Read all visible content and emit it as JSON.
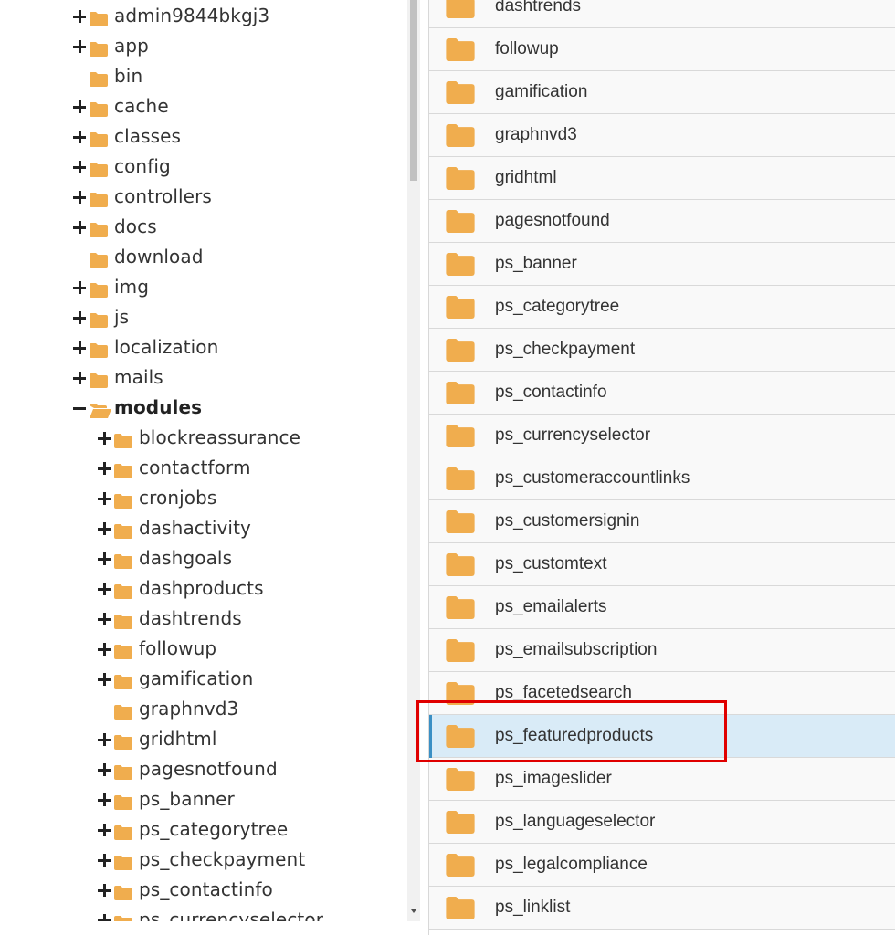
{
  "colors": {
    "folder": "#f0ad4e",
    "selected_row": "#d9ebf7",
    "highlight": "#e00000"
  },
  "tree": {
    "items": [
      {
        "label": "admin9844bkgj3",
        "toggle": "plus",
        "level": 0
      },
      {
        "label": "app",
        "toggle": "plus",
        "level": 0
      },
      {
        "label": "bin",
        "toggle": "none",
        "level": 0
      },
      {
        "label": "cache",
        "toggle": "plus",
        "level": 0
      },
      {
        "label": "classes",
        "toggle": "plus",
        "level": 0
      },
      {
        "label": "config",
        "toggle": "plus",
        "level": 0
      },
      {
        "label": "controllers",
        "toggle": "plus",
        "level": 0
      },
      {
        "label": "docs",
        "toggle": "plus",
        "level": 0
      },
      {
        "label": "download",
        "toggle": "none",
        "level": 0
      },
      {
        "label": "img",
        "toggle": "plus",
        "level": 0
      },
      {
        "label": "js",
        "toggle": "plus",
        "level": 0
      },
      {
        "label": "localization",
        "toggle": "plus",
        "level": 0
      },
      {
        "label": "mails",
        "toggle": "plus",
        "level": 0
      },
      {
        "label": "modules",
        "toggle": "minus",
        "level": 0,
        "open": true,
        "bold": true
      },
      {
        "label": "blockreassurance",
        "toggle": "plus",
        "level": 1
      },
      {
        "label": "contactform",
        "toggle": "plus",
        "level": 1
      },
      {
        "label": "cronjobs",
        "toggle": "plus",
        "level": 1
      },
      {
        "label": "dashactivity",
        "toggle": "plus",
        "level": 1
      },
      {
        "label": "dashgoals",
        "toggle": "plus",
        "level": 1
      },
      {
        "label": "dashproducts",
        "toggle": "plus",
        "level": 1
      },
      {
        "label": "dashtrends",
        "toggle": "plus",
        "level": 1
      },
      {
        "label": "followup",
        "toggle": "plus",
        "level": 1
      },
      {
        "label": "gamification",
        "toggle": "plus",
        "level": 1
      },
      {
        "label": "graphnvd3",
        "toggle": "none",
        "level": 1
      },
      {
        "label": "gridhtml",
        "toggle": "plus",
        "level": 1
      },
      {
        "label": "pagesnotfound",
        "toggle": "plus",
        "level": 1
      },
      {
        "label": "ps_banner",
        "toggle": "plus",
        "level": 1
      },
      {
        "label": "ps_categorytree",
        "toggle": "plus",
        "level": 1
      },
      {
        "label": "ps_checkpayment",
        "toggle": "plus",
        "level": 1
      },
      {
        "label": "ps_contactinfo",
        "toggle": "plus",
        "level": 1
      },
      {
        "label": "ps_currencyselector",
        "toggle": "plus",
        "level": 1
      }
    ]
  },
  "list": {
    "items": [
      {
        "label": "dashtrends"
      },
      {
        "label": "followup"
      },
      {
        "label": "gamification"
      },
      {
        "label": "graphnvd3"
      },
      {
        "label": "gridhtml"
      },
      {
        "label": "pagesnotfound"
      },
      {
        "label": "ps_banner"
      },
      {
        "label": "ps_categorytree"
      },
      {
        "label": "ps_checkpayment"
      },
      {
        "label": "ps_contactinfo"
      },
      {
        "label": "ps_currencyselector"
      },
      {
        "label": "ps_customeraccountlinks"
      },
      {
        "label": "ps_customersignin"
      },
      {
        "label": "ps_customtext"
      },
      {
        "label": "ps_emailalerts"
      },
      {
        "label": "ps_emailsubscription"
      },
      {
        "label": "ps_facetedsearch"
      },
      {
        "label": "ps_featuredproducts",
        "selected": true
      },
      {
        "label": "ps_imageslider"
      },
      {
        "label": "ps_languageselector"
      },
      {
        "label": "ps_legalcompliance"
      },
      {
        "label": "ps_linklist"
      }
    ]
  }
}
